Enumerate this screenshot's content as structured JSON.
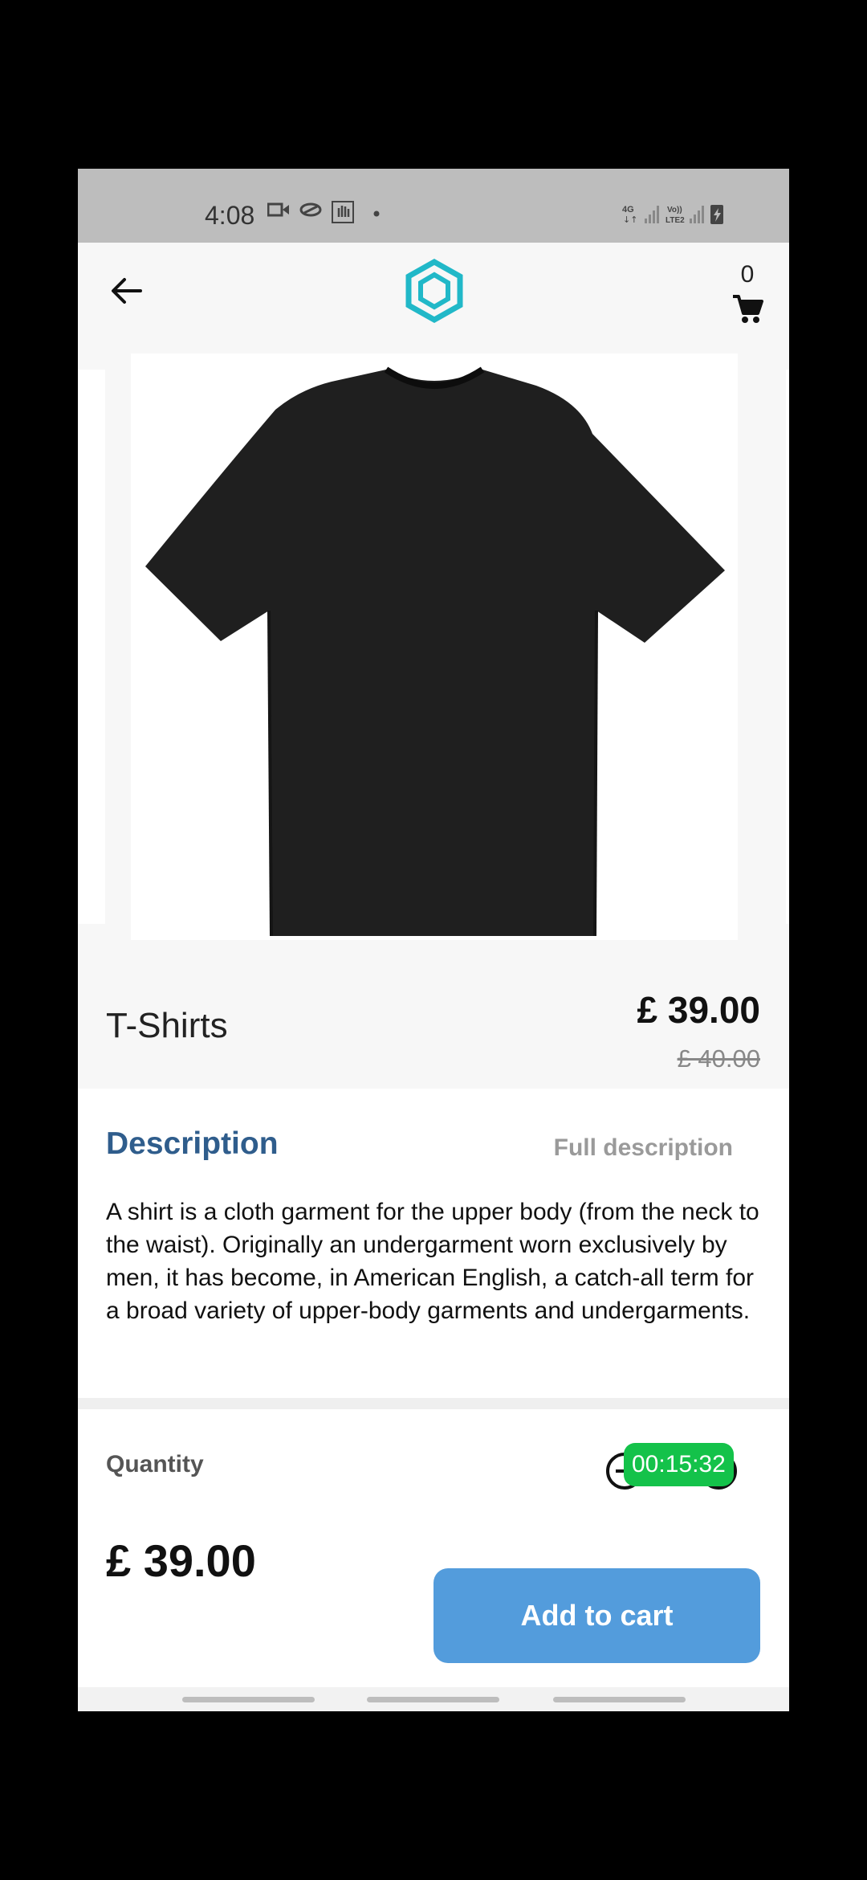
{
  "status_bar": {
    "time": "4:08",
    "left_icons": [
      "video-icon",
      "swirl-icon",
      "hand-icon",
      "dot-icon"
    ],
    "right_icons": [
      "4g-icon",
      "signal-icon",
      "volte-icon",
      "signal-icon",
      "battery-icon"
    ],
    "net_label": "4G",
    "volte_label": "Vo)) LTE2"
  },
  "app_bar": {
    "back_icon": "arrow-left-icon",
    "logo_icon": "hexagon-logo-icon",
    "cart_count": "0",
    "cart_icon": "shopping-cart-icon"
  },
  "product": {
    "title": "T-Shirts",
    "price": "£ 39.00",
    "old_price": "£ 40.00",
    "image": "black-tshirt-image"
  },
  "description": {
    "title": "Description",
    "full_link": "Full description",
    "text": "A shirt is a cloth garment for the upper body (from the neck to the waist). Originally an undergarment worn exclusively by men, it has become, in American English, a catch-all term for a broad variety of upper-body garments and undergarments."
  },
  "quantity": {
    "label": "Quantity",
    "timer": "00:15:32"
  },
  "footer": {
    "total": "£ 39.00",
    "add_to_cart": "Add to cart"
  },
  "colors": {
    "accent": "#2f5d8c",
    "button": "#539cdc",
    "logo": "#21b8c8",
    "timer": "#14c24a"
  }
}
